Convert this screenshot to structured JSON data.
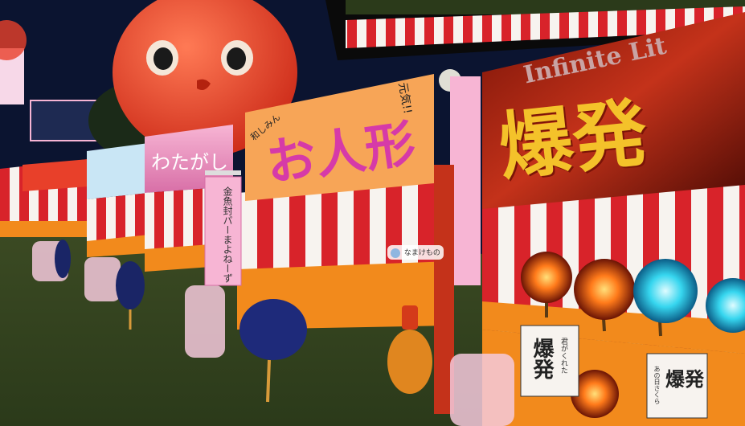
{
  "stalls": {
    "ningyo": {
      "sign_text": "お人形",
      "note_top_right": "元気!!",
      "note_top_left": "和しみん"
    },
    "wataame": {
      "sign_text": "わたがし"
    },
    "bakuhatsu": {
      "banner_en": "Infinite Lit",
      "banner_jp": "爆発"
    },
    "banner_vertical": {
      "text": "金魚封パーまよねーず"
    }
  },
  "player_tag": {
    "name": "なまけもの"
  },
  "signboards": {
    "bakuhatsu_small_1": {
      "big": "爆発",
      "small": "君がくれた"
    },
    "bakuhatsu_small_2": {
      "big": "爆発",
      "small": "あの日さくら"
    }
  },
  "colors": {
    "sky": "#0b1430",
    "stripe_red": "#d8232a",
    "stripe_white": "#f7f3ef",
    "counter_orange": "#f28a1c",
    "tomato": "#e8402a"
  }
}
